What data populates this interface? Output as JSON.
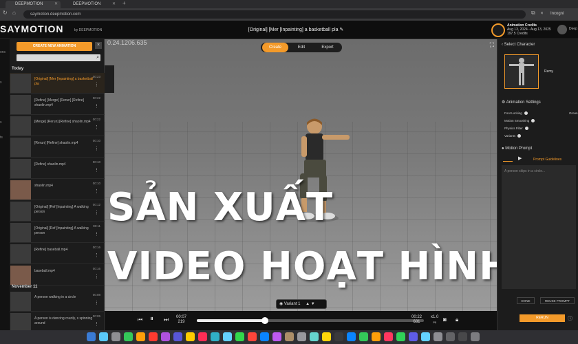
{
  "browser": {
    "tabs": [
      {
        "label": "DEEPMOTION"
      },
      {
        "label": "DEEPMOTION"
      }
    ],
    "url": "saymotion.deepmotion.com",
    "profile": "Incogni"
  },
  "header": {
    "logo": "SAYMOTION",
    "logo_sub": "by DEEPMOTION",
    "project_title": "[Original] [Mer [Inpainting] a basketball pla ✎",
    "credits_label": "Animation Credits",
    "credits_dates": "Aug 13, 2024 - Aug 13, 2025",
    "credits_value": "197.5 Credits",
    "user": "Deep"
  },
  "left_rail": [
    "ons",
    "s",
    "s",
    "ts"
  ],
  "left_panel": {
    "create_button": "CREATE NEW ANIMATION",
    "sections": [
      {
        "label": "Today",
        "items": [
          {
            "title": "[Original] [Mer [Inpainting] a basketball pla",
            "time": "00:23",
            "selected": true,
            "photo": false
          },
          {
            "title": "[Refine] [Merge] [Rerun] [Refine] shaolin.mp4",
            "time": "00:22",
            "selected": false,
            "photo": false
          },
          {
            "title": "[Merge] [Rerun] [Refine] shaolin.mp4",
            "time": "00:22",
            "selected": false,
            "photo": false
          },
          {
            "title": "[Rerun] [Refine] shaolin.mp4",
            "time": "00:10",
            "selected": false,
            "photo": false
          },
          {
            "title": "[Refine] shaolin.mp4",
            "time": "00:10",
            "selected": false,
            "photo": false
          },
          {
            "title": "shaolin.mp4",
            "time": "00:10",
            "selected": false,
            "photo": true
          },
          {
            "title": "[Original] [Ref [Inpainting] A walking person",
            "time": "00:12",
            "selected": false,
            "photo": false
          },
          {
            "title": "[Original] [Ref [Inpainting] A walking person",
            "time": "00:11",
            "selected": false,
            "photo": false
          },
          {
            "title": "[Refine] baseball.mp4",
            "time": "00:16",
            "selected": false,
            "photo": false
          },
          {
            "title": "baseball.mp4",
            "time": "00:16",
            "selected": false,
            "photo": true
          }
        ]
      },
      {
        "label": "November 11",
        "items": [
          {
            "title": "A person walking in a circle",
            "time": "00:08",
            "selected": false,
            "photo": false
          },
          {
            "title": "A person is dancing crazily, s spinning around",
            "time": "00:05",
            "selected": false,
            "photo": false
          }
        ]
      }
    ]
  },
  "stage": {
    "code": "0.24.1206.635",
    "modes": [
      {
        "label": "Create",
        "active": true
      },
      {
        "label": "Edit",
        "active": false
      },
      {
        "label": "Export",
        "active": false
      }
    ],
    "banner_line1": "SẢN XUẤT",
    "banner_line2": "VIDEO HOẠT HÌNH",
    "variant_label": "Variant 1",
    "time_current": "00:07",
    "frame_current": "219",
    "time_total": "00:22",
    "frame_total": "681",
    "speed": "x1.0",
    "speed_sub": "P5",
    "progress": 0.3
  },
  "right_panel": {
    "select_character": "Select Character",
    "character_name": "Remy",
    "animation_settings": "Animation Settings",
    "settings": [
      "Foot Locking",
      "Motion Smoothing",
      "Physics Filter",
      "Variants"
    ],
    "ground_label": "Groun",
    "motion_prompt": "Motion Prompt",
    "prompt_guidelines": "Prompt Guidelines",
    "prompt_placeholder": "A person skips in a circle...",
    "done_button": "DONE",
    "reuse_button": "REUSE PROMPT",
    "rerun_button": "RERUN"
  },
  "colors": {
    "accent": "#f39a2a"
  }
}
